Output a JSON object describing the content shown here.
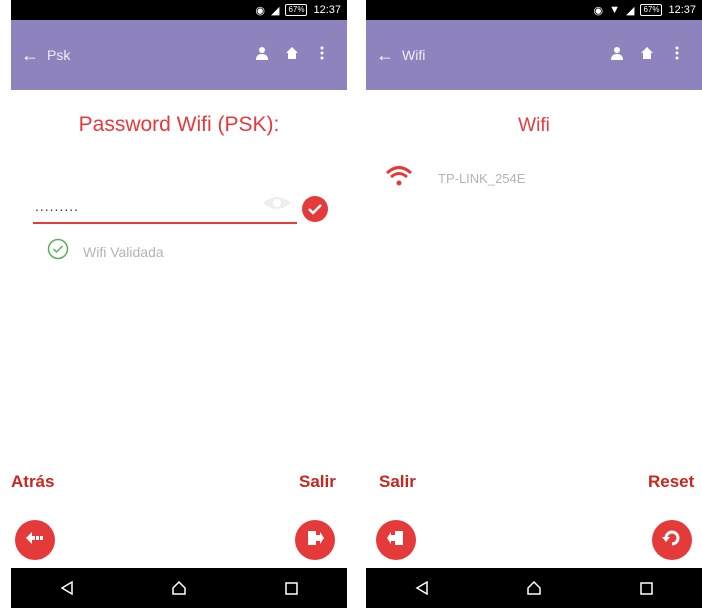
{
  "status_bar": {
    "time": "12:37",
    "battery": "67%"
  },
  "left_screen": {
    "toolbar_title": "Psk",
    "heading": "Password Wifi (PSK):",
    "password_value": ".........",
    "validated_label": "Wifi Validada",
    "left_button_label": "Atrás",
    "right_button_label": "Salir"
  },
  "right_screen": {
    "toolbar_title": "Wifi",
    "heading": "Wifi",
    "network_ssid": "TP-LINK_254E",
    "left_button_label": "Salir",
    "right_button_label": "Reset"
  },
  "colors": {
    "accent": "#e53a3a",
    "toolbar": "#8f83bd",
    "label_red": "#c8261f"
  },
  "icons": [
    "back-arrow-icon",
    "person-icon",
    "home-icon",
    "more-vert-icon",
    "eye-icon",
    "check-icon",
    "check-circle-icon",
    "wifi-icon",
    "exit-icon",
    "reset-icon",
    "nav-back-icon",
    "nav-home-icon",
    "nav-recents-icon"
  ]
}
